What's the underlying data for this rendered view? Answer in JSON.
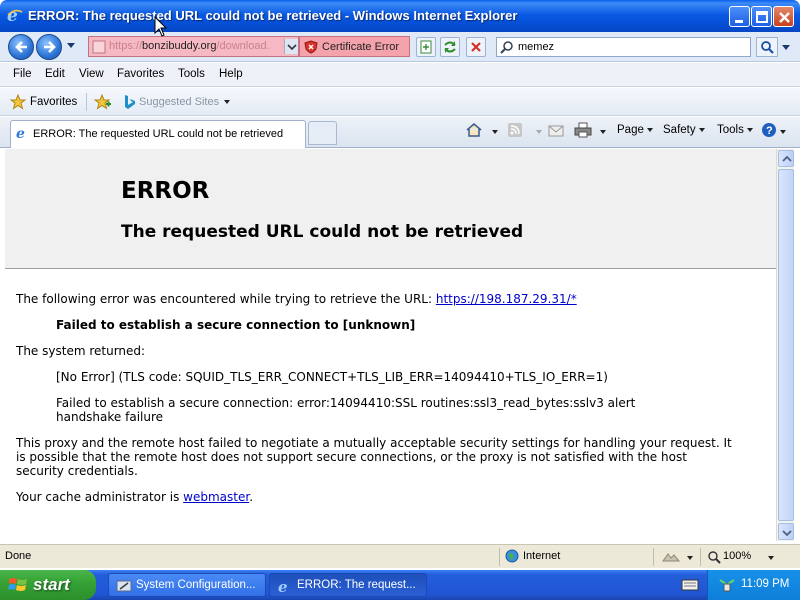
{
  "window": {
    "title": "ERROR: The requested URL could not be retrieved - Windows Internet Explorer"
  },
  "address_bar": {
    "url_prefix": "https://",
    "url_host": "bonzibuddy.org",
    "url_path": "/download.",
    "cert_error_label": "Certificate Error"
  },
  "search": {
    "value": "memez"
  },
  "menu": [
    "File",
    "Edit",
    "View",
    "Favorites",
    "Tools",
    "Help"
  ],
  "favorites_bar": {
    "favorites_label": "Favorites",
    "suggested_sites_label": "Suggested Sites"
  },
  "tab": {
    "label": "ERROR: The requested URL could not be retrieved"
  },
  "command_bar": {
    "page_label": "Page",
    "safety_label": "Safety",
    "tools_label": "Tools"
  },
  "page": {
    "heading": "ERROR",
    "subheading": "The requested URL could not be retrieved",
    "intro_text": "The following error was encountered while trying to retrieve the URL: ",
    "intro_link": "https://198.187.29.31/*",
    "error_summary": "Failed to establish a secure connection to [unknown]",
    "system_returned": "The system returned:",
    "tls_code": "[No Error] (TLS code: SQUID_TLS_ERR_CONNECT+TLS_LIB_ERR=14094410+TLS_IO_ERR=1)",
    "ssl_error_line1": "Failed to establish a secure connection: error:14094410:SSL routines:ssl3_read_bytes:sslv3 alert",
    "ssl_error_line2": "handshake failure",
    "explanation_line1": "This proxy and the remote host failed to negotiate a mutually acceptable security settings for handling your request. It",
    "explanation_line2": "is possible that the remote host does not support secure connections, or the proxy is not satisfied with the host",
    "explanation_line3": "security credentials.",
    "admin_text": "Your cache administrator is ",
    "admin_link": "webmaster",
    "admin_suffix": "."
  },
  "status_bar": {
    "status": "Done",
    "zone": "Internet",
    "zoom": "100%"
  },
  "taskbar": {
    "start_label": "start",
    "items": [
      {
        "label": "System Configuration..."
      },
      {
        "label": "ERROR: The request..."
      }
    ],
    "clock": "11:09 PM"
  },
  "colors": {
    "titlebar": "#0b5ae4",
    "cert_error_bg": "#f4a2ac",
    "link": "#0000cc",
    "taskbar": "#245edb",
    "start_button": "#36a336"
  }
}
